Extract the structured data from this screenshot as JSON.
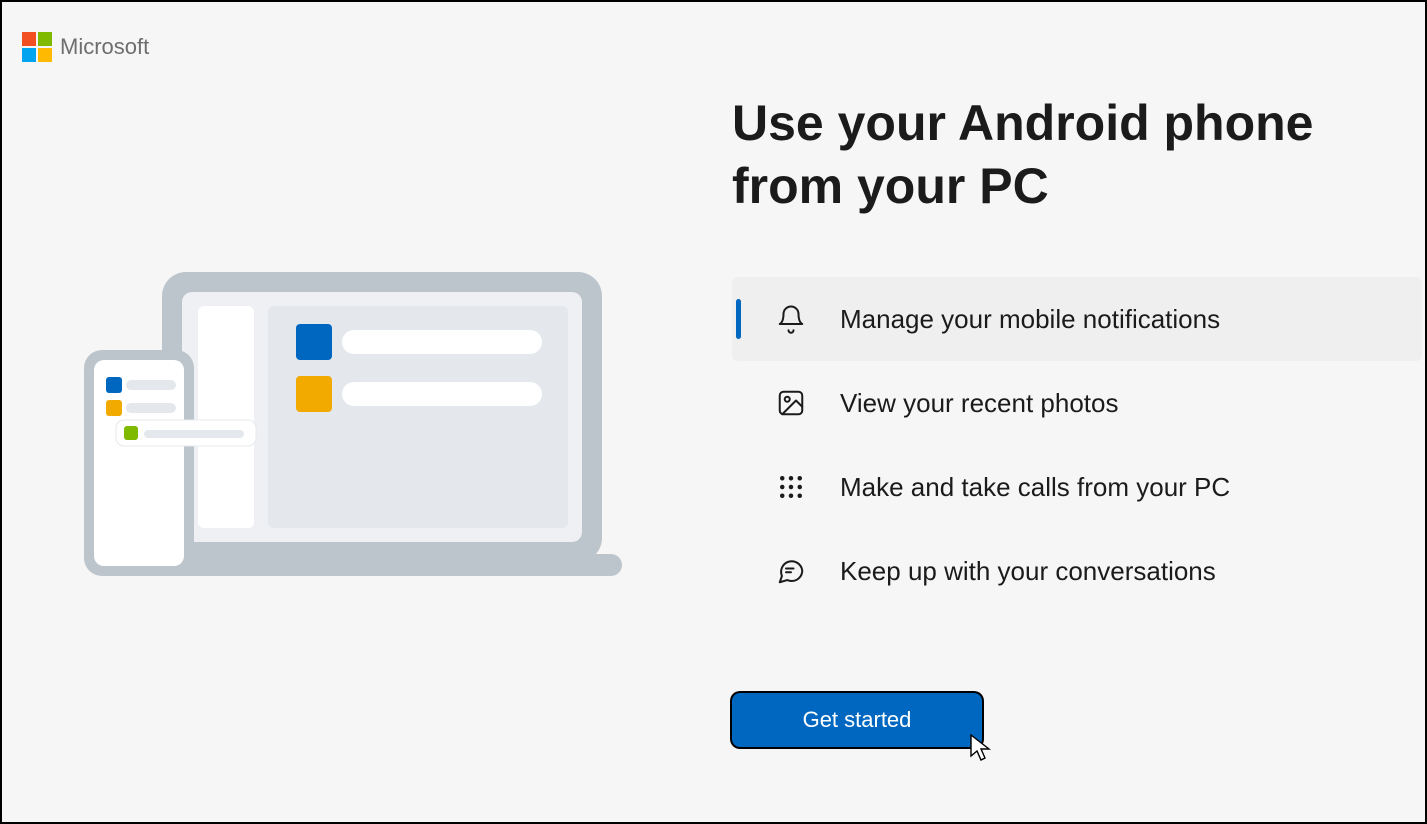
{
  "brand": "Microsoft",
  "heading": "Use your Android phone from your PC",
  "features": [
    {
      "label": "Manage your mobile notifications",
      "icon": "bell-icon",
      "active": true
    },
    {
      "label": "View your recent photos",
      "icon": "photo-icon",
      "active": false
    },
    {
      "label": "Make and take calls from your PC",
      "icon": "dialpad-icon",
      "active": false
    },
    {
      "label": "Keep up with your conversations",
      "icon": "chat-icon",
      "active": false
    }
  ],
  "cta_label": "Get started"
}
